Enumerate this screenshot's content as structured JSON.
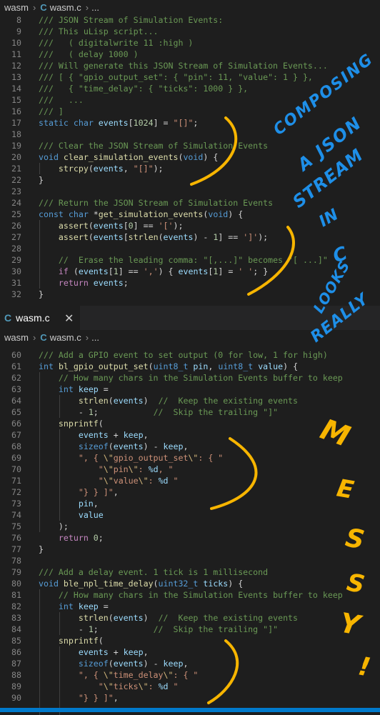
{
  "breadcrumb_top": {
    "folder": "wasm",
    "file": "wasm.c",
    "more": "..."
  },
  "tab": {
    "file": "wasm.c",
    "close": "✕"
  },
  "breadcrumb_bottom": {
    "folder": "wasm",
    "file": "wasm.c",
    "more": "..."
  },
  "pane1": [
    {
      "n": "8",
      "t": [
        [
          "c",
          "/// JSON Stream of Simulation Events:"
        ]
      ]
    },
    {
      "n": "9",
      "t": [
        [
          "c",
          "/// This uLisp script..."
        ]
      ]
    },
    {
      "n": "10",
      "t": [
        [
          "c",
          "///   ( digitalwrite 11 :high )"
        ]
      ]
    },
    {
      "n": "11",
      "t": [
        [
          "c",
          "///   ( delay 1000 )"
        ]
      ]
    },
    {
      "n": "12",
      "t": [
        [
          "c",
          "/// Will generate this JSON Stream of Simulation Events..."
        ]
      ]
    },
    {
      "n": "13",
      "t": [
        [
          "c",
          "/// [ { \"gpio_output_set\": { \"pin\": 11, \"value\": 1 } },"
        ]
      ]
    },
    {
      "n": "14",
      "t": [
        [
          "c",
          "///   { \"time_delay\": { \"ticks\": 1000 } },"
        ]
      ]
    },
    {
      "n": "15",
      "t": [
        [
          "c",
          "///   ..."
        ]
      ]
    },
    {
      "n": "16",
      "t": [
        [
          "c",
          "/// ]"
        ]
      ]
    },
    {
      "n": "17",
      "t": [
        [
          "k",
          "static"
        ],
        [
          "p",
          " "
        ],
        [
          "k",
          "char"
        ],
        [
          "p",
          " "
        ],
        [
          "v",
          "events"
        ],
        [
          "p",
          "["
        ],
        [
          "n",
          "1024"
        ],
        [
          "p",
          "] = "
        ],
        [
          "s",
          "\"[]\""
        ],
        [
          "p",
          ";"
        ]
      ]
    },
    {
      "n": "18",
      "t": []
    },
    {
      "n": "19",
      "t": [
        [
          "c",
          "/// Clear the JSON Stream of Simulation Events"
        ]
      ]
    },
    {
      "n": "20",
      "t": [
        [
          "k",
          "void"
        ],
        [
          "p",
          " "
        ],
        [
          "f",
          "clear_simulation_events"
        ],
        [
          "p",
          "("
        ],
        [
          "k",
          "void"
        ],
        [
          "p",
          ") {"
        ]
      ]
    },
    {
      "n": "21",
      "t": [
        [
          "p",
          "    "
        ],
        [
          "f",
          "strcpy"
        ],
        [
          "p",
          "("
        ],
        [
          "v",
          "events"
        ],
        [
          "p",
          ", "
        ],
        [
          "s",
          "\"[]\""
        ],
        [
          "p",
          ");"
        ]
      ]
    },
    {
      "n": "22",
      "t": [
        [
          "p",
          "}"
        ]
      ]
    },
    {
      "n": "23",
      "t": []
    },
    {
      "n": "24",
      "t": [
        [
          "c",
          "/// Return the JSON Stream of Simulation Events"
        ]
      ]
    },
    {
      "n": "25",
      "t": [
        [
          "k",
          "const"
        ],
        [
          "p",
          " "
        ],
        [
          "k",
          "char"
        ],
        [
          "p",
          " *"
        ],
        [
          "f",
          "get_simulation_events"
        ],
        [
          "p",
          "("
        ],
        [
          "k",
          "void"
        ],
        [
          "p",
          ") {"
        ]
      ]
    },
    {
      "n": "26",
      "t": [
        [
          "p",
          "    "
        ],
        [
          "f",
          "assert"
        ],
        [
          "p",
          "("
        ],
        [
          "v",
          "events"
        ],
        [
          "p",
          "["
        ],
        [
          "n",
          "0"
        ],
        [
          "p",
          "] == "
        ],
        [
          "s",
          "'['"
        ],
        [
          "p",
          ");"
        ]
      ]
    },
    {
      "n": "27",
      "t": [
        [
          "p",
          "    "
        ],
        [
          "f",
          "assert"
        ],
        [
          "p",
          "("
        ],
        [
          "v",
          "events"
        ],
        [
          "p",
          "["
        ],
        [
          "f",
          "strlen"
        ],
        [
          "p",
          "("
        ],
        [
          "v",
          "events"
        ],
        [
          "p",
          ") - "
        ],
        [
          "n",
          "1"
        ],
        [
          "p",
          "] == "
        ],
        [
          "s",
          "']'"
        ],
        [
          "p",
          ");"
        ]
      ]
    },
    {
      "n": "28",
      "t": []
    },
    {
      "n": "29",
      "t": [
        [
          "p",
          "    "
        ],
        [
          "c",
          "//  Erase the leading comma: \"[,...]\" becomes \"[ ...]\""
        ]
      ]
    },
    {
      "n": "30",
      "t": [
        [
          "p",
          "    "
        ],
        [
          "kc",
          "if"
        ],
        [
          "p",
          " ("
        ],
        [
          "v",
          "events"
        ],
        [
          "p",
          "["
        ],
        [
          "n",
          "1"
        ],
        [
          "p",
          "] == "
        ],
        [
          "s",
          "','"
        ],
        [
          "p",
          ") { "
        ],
        [
          "v",
          "events"
        ],
        [
          "p",
          "["
        ],
        [
          "n",
          "1"
        ],
        [
          "p",
          "] = "
        ],
        [
          "s",
          "' '"
        ],
        [
          "p",
          "; }"
        ]
      ]
    },
    {
      "n": "31",
      "t": [
        [
          "p",
          "    "
        ],
        [
          "kc",
          "return"
        ],
        [
          "p",
          " "
        ],
        [
          "v",
          "events"
        ],
        [
          "p",
          ";"
        ]
      ]
    },
    {
      "n": "32",
      "t": [
        [
          "p",
          "}"
        ]
      ]
    }
  ],
  "pane2": [
    {
      "n": "60",
      "t": [
        [
          "c",
          "/// Add a GPIO event to set output (0 for low, 1 for high)"
        ]
      ]
    },
    {
      "n": "61",
      "t": [
        [
          "k",
          "int"
        ],
        [
          "p",
          " "
        ],
        [
          "f",
          "bl_gpio_output_set"
        ],
        [
          "p",
          "("
        ],
        [
          "k",
          "uint8_t"
        ],
        [
          "p",
          " "
        ],
        [
          "v",
          "pin"
        ],
        [
          "p",
          ", "
        ],
        [
          "k",
          "uint8_t"
        ],
        [
          "p",
          " "
        ],
        [
          "v",
          "value"
        ],
        [
          "p",
          ") {"
        ]
      ]
    },
    {
      "n": "62",
      "t": [
        [
          "p",
          "    "
        ],
        [
          "c",
          "// How many chars in the Simulation Events buffer to keep"
        ]
      ]
    },
    {
      "n": "63",
      "t": [
        [
          "p",
          "    "
        ],
        [
          "k",
          "int"
        ],
        [
          "p",
          " "
        ],
        [
          "v",
          "keep"
        ],
        [
          "p",
          " ="
        ]
      ]
    },
    {
      "n": "64",
      "t": [
        [
          "p",
          "        "
        ],
        [
          "f",
          "strlen"
        ],
        [
          "p",
          "("
        ],
        [
          "v",
          "events"
        ],
        [
          "p",
          ")  "
        ],
        [
          "c",
          "//  Keep the existing events"
        ]
      ]
    },
    {
      "n": "65",
      "t": [
        [
          "p",
          "        - "
        ],
        [
          "n",
          "1"
        ],
        [
          "p",
          ";           "
        ],
        [
          "c",
          "//  Skip the trailing \"]\""
        ]
      ]
    },
    {
      "n": "66",
      "t": [
        [
          "p",
          "    "
        ],
        [
          "f",
          "snprintf"
        ],
        [
          "p",
          "("
        ]
      ]
    },
    {
      "n": "67",
      "t": [
        [
          "p",
          "        "
        ],
        [
          "v",
          "events"
        ],
        [
          "p",
          " + "
        ],
        [
          "v",
          "keep"
        ],
        [
          "p",
          ","
        ]
      ]
    },
    {
      "n": "68",
      "t": [
        [
          "p",
          "        "
        ],
        [
          "k",
          "sizeof"
        ],
        [
          "p",
          "("
        ],
        [
          "v",
          "events"
        ],
        [
          "p",
          ") - "
        ],
        [
          "v",
          "keep"
        ],
        [
          "p",
          ","
        ]
      ]
    },
    {
      "n": "69",
      "t": [
        [
          "p",
          "        "
        ],
        [
          "s",
          "\", { "
        ],
        [
          "e",
          "\\\""
        ],
        [
          "s",
          "gpio_output_set"
        ],
        [
          "e",
          "\\\""
        ],
        [
          "s",
          ": { \""
        ]
      ]
    },
    {
      "n": "70",
      "t": [
        [
          "p",
          "            "
        ],
        [
          "s",
          "\""
        ],
        [
          "e",
          "\\\""
        ],
        [
          "s",
          "pin"
        ],
        [
          "e",
          "\\\""
        ],
        [
          "s",
          ": "
        ],
        [
          "v",
          "%d"
        ],
        [
          "s",
          ", \""
        ]
      ]
    },
    {
      "n": "71",
      "t": [
        [
          "p",
          "            "
        ],
        [
          "s",
          "\""
        ],
        [
          "e",
          "\\\""
        ],
        [
          "s",
          "value"
        ],
        [
          "e",
          "\\\""
        ],
        [
          "s",
          ": "
        ],
        [
          "v",
          "%d"
        ],
        [
          "s",
          " \""
        ]
      ]
    },
    {
      "n": "72",
      "t": [
        [
          "p",
          "        "
        ],
        [
          "s",
          "\"} } ]\""
        ],
        [
          "p",
          ","
        ]
      ]
    },
    {
      "n": "73",
      "t": [
        [
          "p",
          "        "
        ],
        [
          "v",
          "pin"
        ],
        [
          "p",
          ","
        ]
      ]
    },
    {
      "n": "74",
      "t": [
        [
          "p",
          "        "
        ],
        [
          "v",
          "value"
        ]
      ]
    },
    {
      "n": "75",
      "t": [
        [
          "p",
          "    );"
        ]
      ]
    },
    {
      "n": "76",
      "t": [
        [
          "p",
          "    "
        ],
        [
          "kc",
          "return"
        ],
        [
          "p",
          " "
        ],
        [
          "n",
          "0"
        ],
        [
          "p",
          ";"
        ]
      ]
    },
    {
      "n": "77",
      "t": [
        [
          "p",
          "}"
        ]
      ]
    },
    {
      "n": "78",
      "t": []
    },
    {
      "n": "79",
      "t": [
        [
          "c",
          "/// Add a delay event. 1 tick is 1 millisecond"
        ]
      ]
    },
    {
      "n": "80",
      "t": [
        [
          "k",
          "void"
        ],
        [
          "p",
          " "
        ],
        [
          "f",
          "ble_npl_time_delay"
        ],
        [
          "p",
          "("
        ],
        [
          "k",
          "uint32_t"
        ],
        [
          "p",
          " "
        ],
        [
          "v",
          "ticks"
        ],
        [
          "p",
          ") {"
        ]
      ]
    },
    {
      "n": "81",
      "t": [
        [
          "p",
          "    "
        ],
        [
          "c",
          "// How many chars in the Simulation Events buffer to keep"
        ]
      ]
    },
    {
      "n": "82",
      "t": [
        [
          "p",
          "    "
        ],
        [
          "k",
          "int"
        ],
        [
          "p",
          " "
        ],
        [
          "v",
          "keep"
        ],
        [
          "p",
          " ="
        ]
      ]
    },
    {
      "n": "83",
      "t": [
        [
          "p",
          "        "
        ],
        [
          "f",
          "strlen"
        ],
        [
          "p",
          "("
        ],
        [
          "v",
          "events"
        ],
        [
          "p",
          ")  "
        ],
        [
          "c",
          "//  Keep the existing events"
        ]
      ]
    },
    {
      "n": "84",
      "t": [
        [
          "p",
          "        - "
        ],
        [
          "n",
          "1"
        ],
        [
          "p",
          ";           "
        ],
        [
          "c",
          "//  Skip the trailing \"]\""
        ]
      ]
    },
    {
      "n": "85",
      "t": [
        [
          "p",
          "    "
        ],
        [
          "f",
          "snprintf"
        ],
        [
          "p",
          "("
        ]
      ]
    },
    {
      "n": "86",
      "t": [
        [
          "p",
          "        "
        ],
        [
          "v",
          "events"
        ],
        [
          "p",
          " + "
        ],
        [
          "v",
          "keep"
        ],
        [
          "p",
          ","
        ]
      ]
    },
    {
      "n": "87",
      "t": [
        [
          "p",
          "        "
        ],
        [
          "k",
          "sizeof"
        ],
        [
          "p",
          "("
        ],
        [
          "v",
          "events"
        ],
        [
          "p",
          ") - "
        ],
        [
          "v",
          "keep"
        ],
        [
          "p",
          ","
        ]
      ]
    },
    {
      "n": "88",
      "t": [
        [
          "p",
          "        "
        ],
        [
          "s",
          "\", { "
        ],
        [
          "e",
          "\\\""
        ],
        [
          "s",
          "time_delay"
        ],
        [
          "e",
          "\\\""
        ],
        [
          "s",
          ": { \""
        ]
      ]
    },
    {
      "n": "89",
      "t": [
        [
          "p",
          "            "
        ],
        [
          "s",
          "\""
        ],
        [
          "e",
          "\\\""
        ],
        [
          "s",
          "ticks"
        ],
        [
          "e",
          "\\\""
        ],
        [
          "s",
          ": "
        ],
        [
          "v",
          "%d"
        ],
        [
          "s",
          " \""
        ]
      ]
    },
    {
      "n": "90",
      "t": [
        [
          "p",
          "        "
        ],
        [
          "s",
          "\"} } ]\""
        ],
        [
          "p",
          ","
        ]
      ]
    }
  ],
  "handwriting": {
    "blue": [
      "COMPOSING",
      "A JSON",
      "STREAM",
      "IN",
      "C",
      "LOOKS",
      "REALLY"
    ],
    "yellow": [
      "M",
      "E",
      "S",
      "S",
      "Y",
      "!"
    ]
  },
  "colors": {
    "blue_ink": "#1e8fe8",
    "yellow_ink": "#f7b500"
  }
}
